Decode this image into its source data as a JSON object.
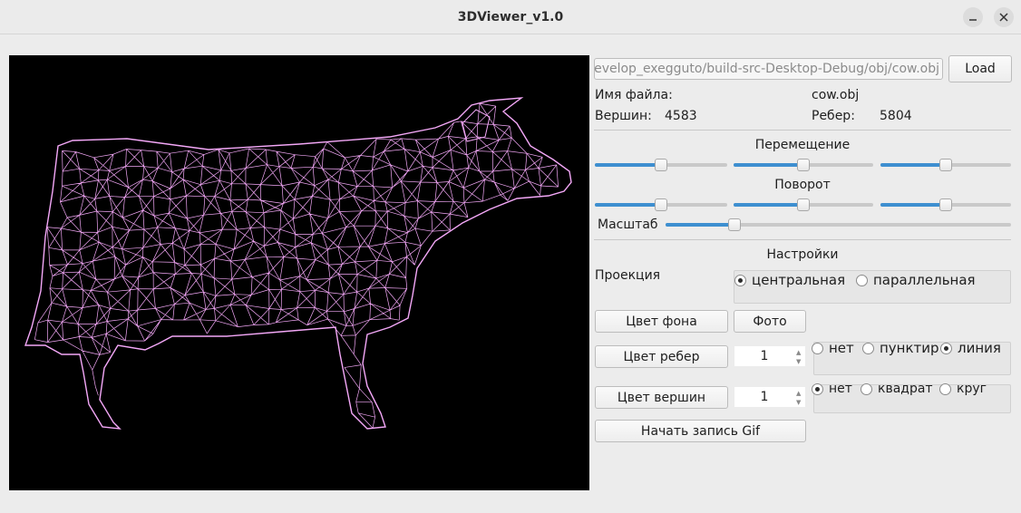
{
  "window": {
    "title": "3DViewer_v1.0"
  },
  "file": {
    "path": "/home/develop_exegguto/build-src-Desktop-Debug/obj/cow.obj",
    "load_label": "Load",
    "name_label": "Имя файла:",
    "name_value": "cow.obj",
    "vertices_label": "Вершин:",
    "vertices_value": "4583",
    "edges_label": "Ребер:",
    "edges_value": "5804"
  },
  "transform": {
    "move_label": "Перемещение",
    "rotate_label": "Поворот",
    "scale_label": "Масштаб",
    "move": [
      0.5,
      0.5,
      0.5
    ],
    "rotate": [
      0.5,
      0.5,
      0.5
    ],
    "scale": 0.2
  },
  "settings": {
    "title": "Настройки",
    "projection_label": "Проекция",
    "projection_options": [
      "центральная",
      "параллельная"
    ],
    "projection_selected": 0,
    "bg_color_label": "Цвет фона",
    "photo_label": "Фото",
    "edge_color_label": "Цвет ребер",
    "edge_size": "1",
    "edge_styles": [
      "нет",
      "пунктир",
      "линия"
    ],
    "edge_style_selected": 2,
    "vertex_color_label": "Цвет вершин",
    "vertex_size": "1",
    "vertex_styles": [
      "нет",
      "квадрат",
      "круг"
    ],
    "vertex_style_selected": 0,
    "gif_label": "Начать запись Gif"
  },
  "colors": {
    "wireframe": "#f4a8f8",
    "background": "#000000",
    "accent": "#3e8fd0"
  }
}
